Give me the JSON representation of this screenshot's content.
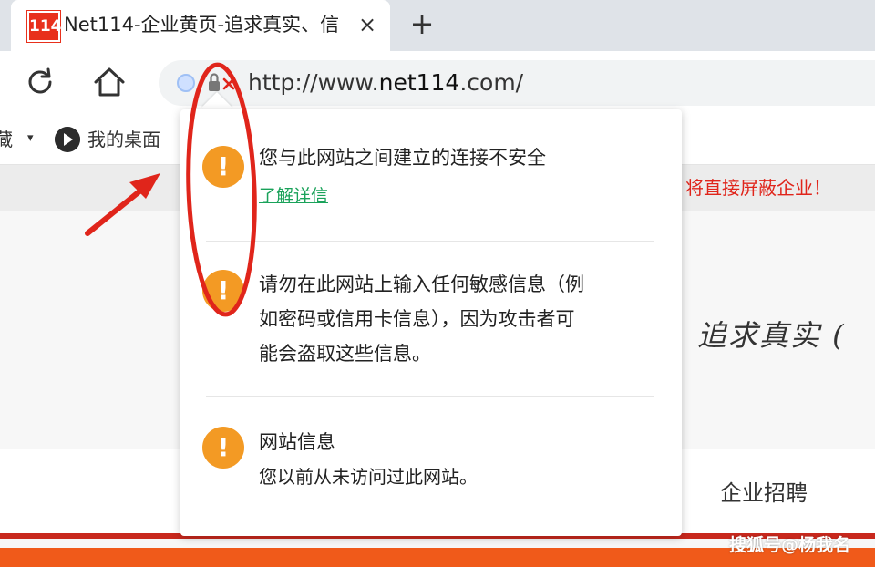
{
  "tab": {
    "favicon_text": "114",
    "title": "Net114-企业黄页-追求真实、信",
    "close_glyph": "×",
    "new_tab_glyph": "+"
  },
  "toolbar": {
    "reload_icon": "reload-icon",
    "home_icon": "home-icon",
    "url_prefix": "http://www.",
    "url_host": "net114",
    "url_suffix": ".com/"
  },
  "bookmarks": {
    "left_partial": "藏",
    "caret": "▾",
    "item_label": "我的桌面"
  },
  "page": {
    "notice": "将直接屏蔽企业！",
    "slogan": "追求真实 (",
    "nav_recruit": "企业招聘",
    "watermark": "搜狐号@杨我名"
  },
  "popup": {
    "sections": [
      {
        "icon": "!",
        "title": "您与此网站之间建立的连接不安全",
        "link": "了解详信"
      },
      {
        "icon": "!",
        "lines": [
          "请勿在此网站上输入任何敏感信息（例",
          "如密码或信用卡信息），因为攻击者可",
          "能会盗取这些信息。"
        ]
      },
      {
        "icon": "!",
        "title": "网站信息",
        "body": "您以前从未访问过此网站。"
      }
    ]
  },
  "colors": {
    "warning": "#f39a24",
    "link": "#1aa25a",
    "annotation_red": "#e0251b",
    "brand_red": "#e8301c",
    "orange_band": "#f05a1a"
  }
}
